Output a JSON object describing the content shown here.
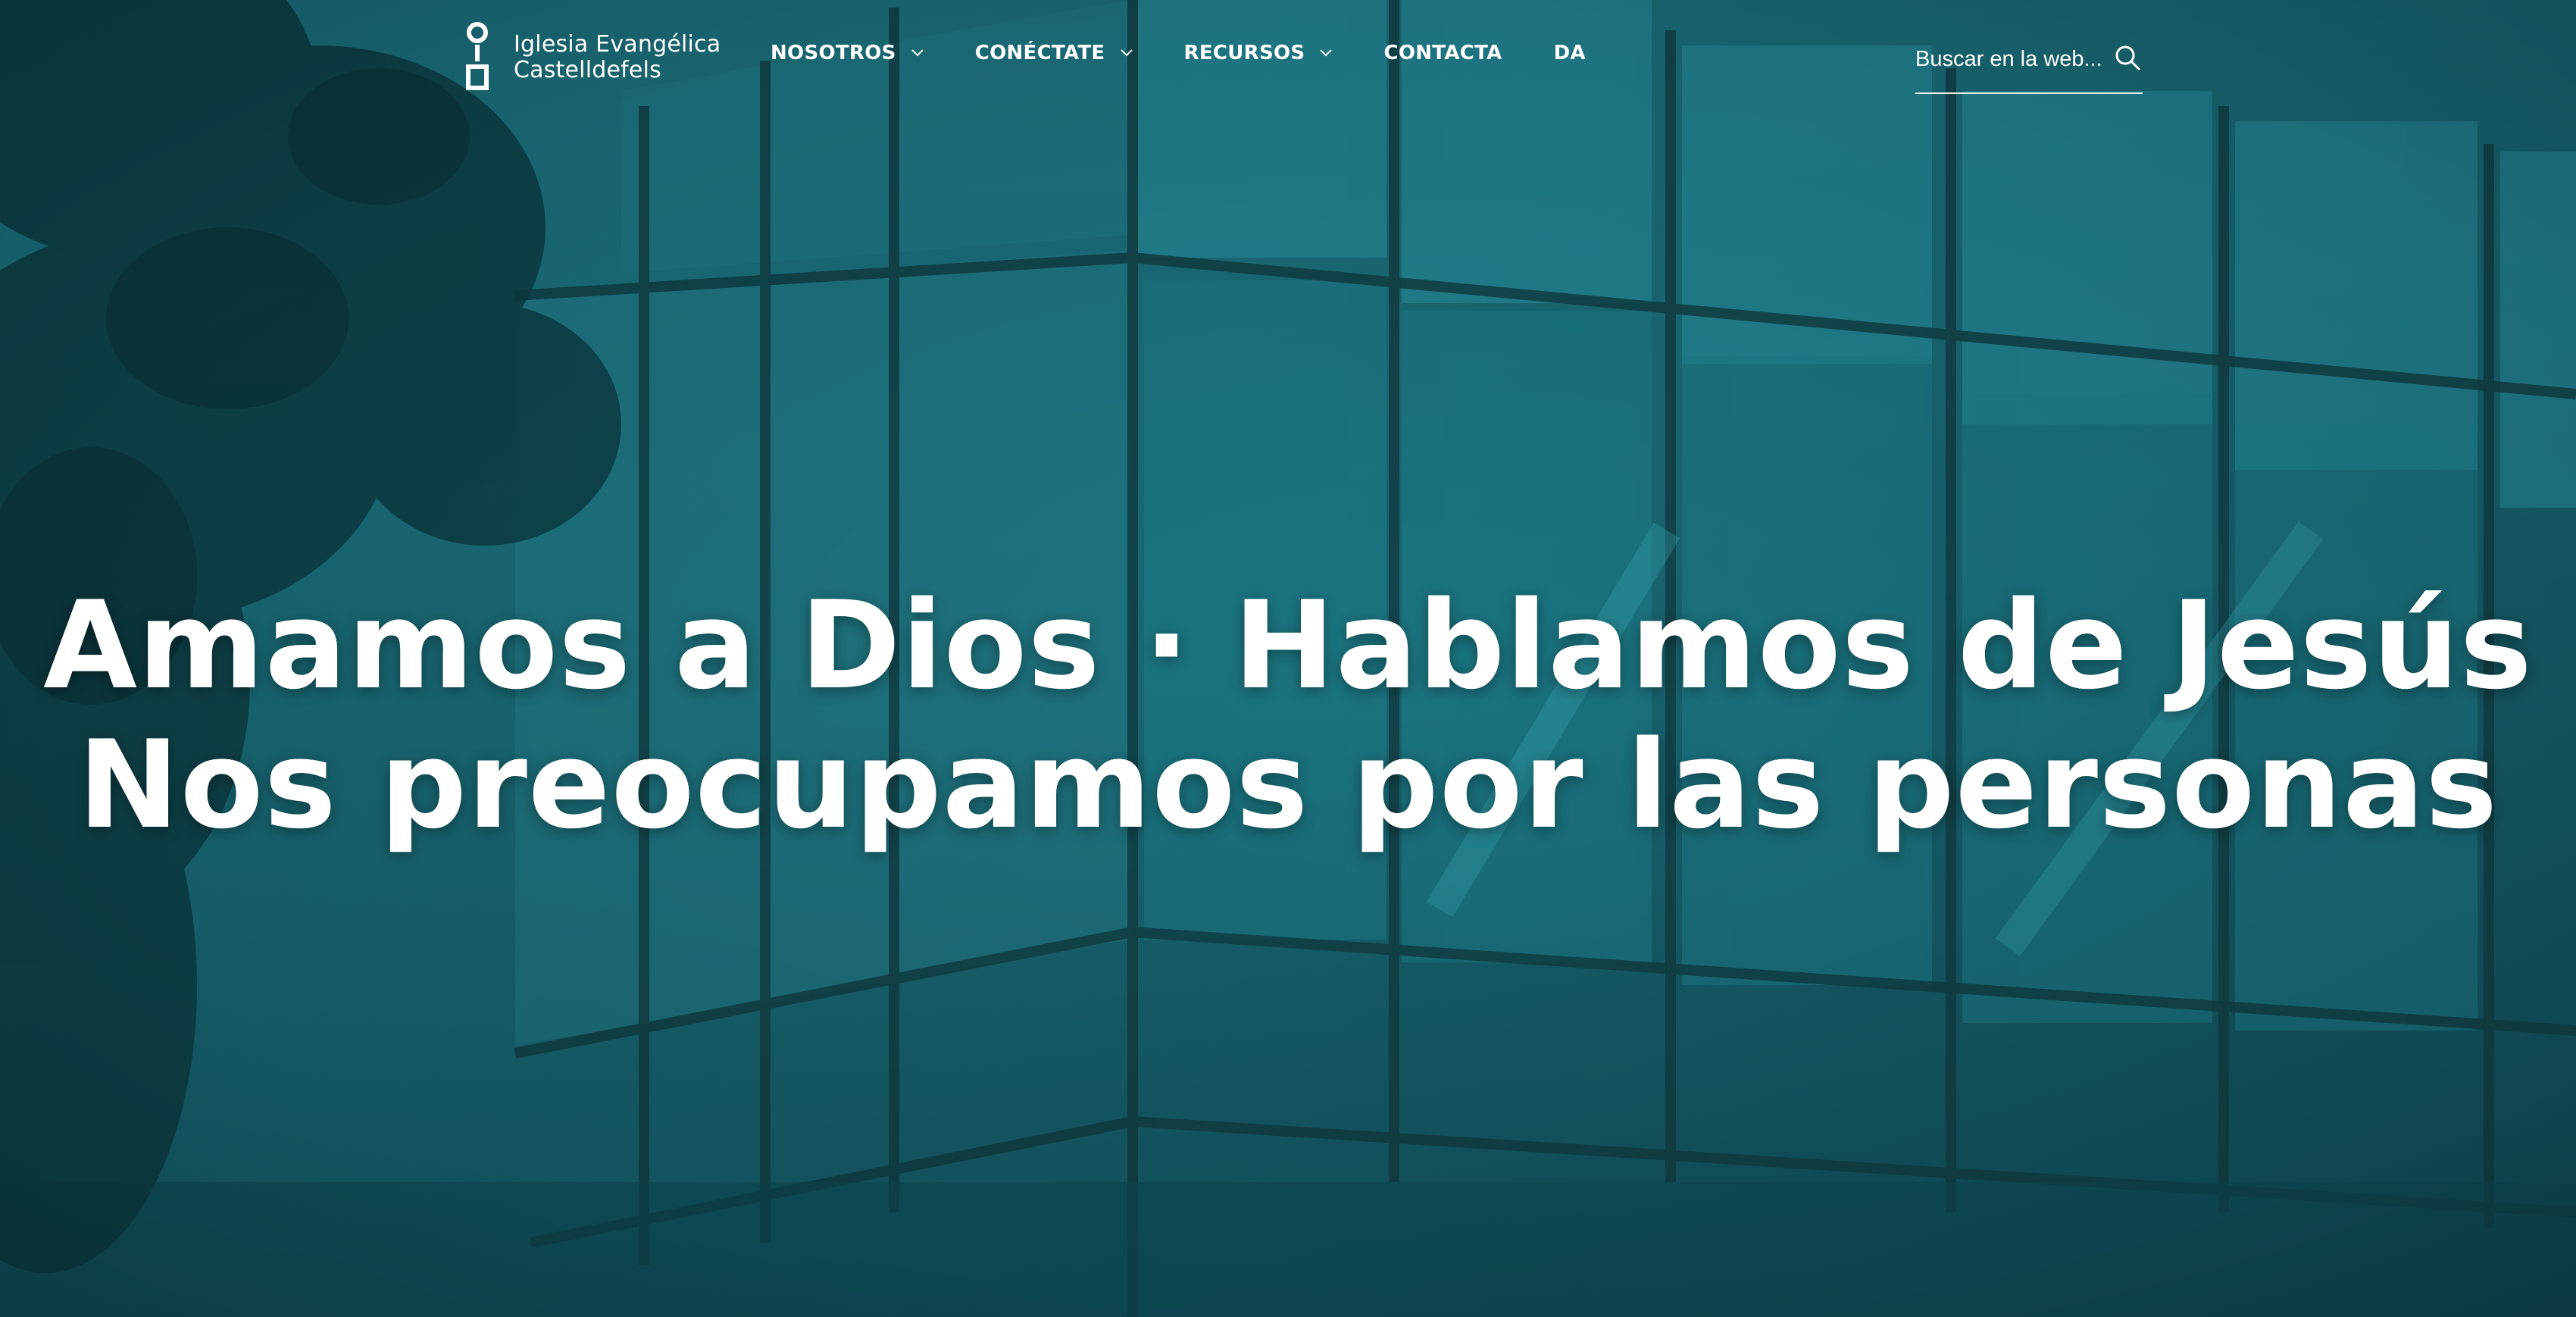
{
  "site": {
    "logo": {
      "line1": "Iglesia Evangélica",
      "line2": "Castelldefels",
      "icon": "church-logo-icon"
    }
  },
  "nav": {
    "items": [
      {
        "label": "NOSOTROS",
        "has_dropdown": true
      },
      {
        "label": "CONÉCTATE",
        "has_dropdown": true
      },
      {
        "label": "RECURSOS",
        "has_dropdown": true
      },
      {
        "label": "CONTACTA",
        "has_dropdown": false
      },
      {
        "label": "DA",
        "has_dropdown": false
      }
    ]
  },
  "search": {
    "placeholder": "Buscar en la web...",
    "value": "",
    "icon": "search-icon"
  },
  "hero": {
    "line1": "Amamos a Dios · Hablamos de Jesús",
    "line2": "Nos preocupamos por las personas"
  },
  "colors": {
    "overlay": "#1a6d78",
    "text": "#ffffff"
  }
}
